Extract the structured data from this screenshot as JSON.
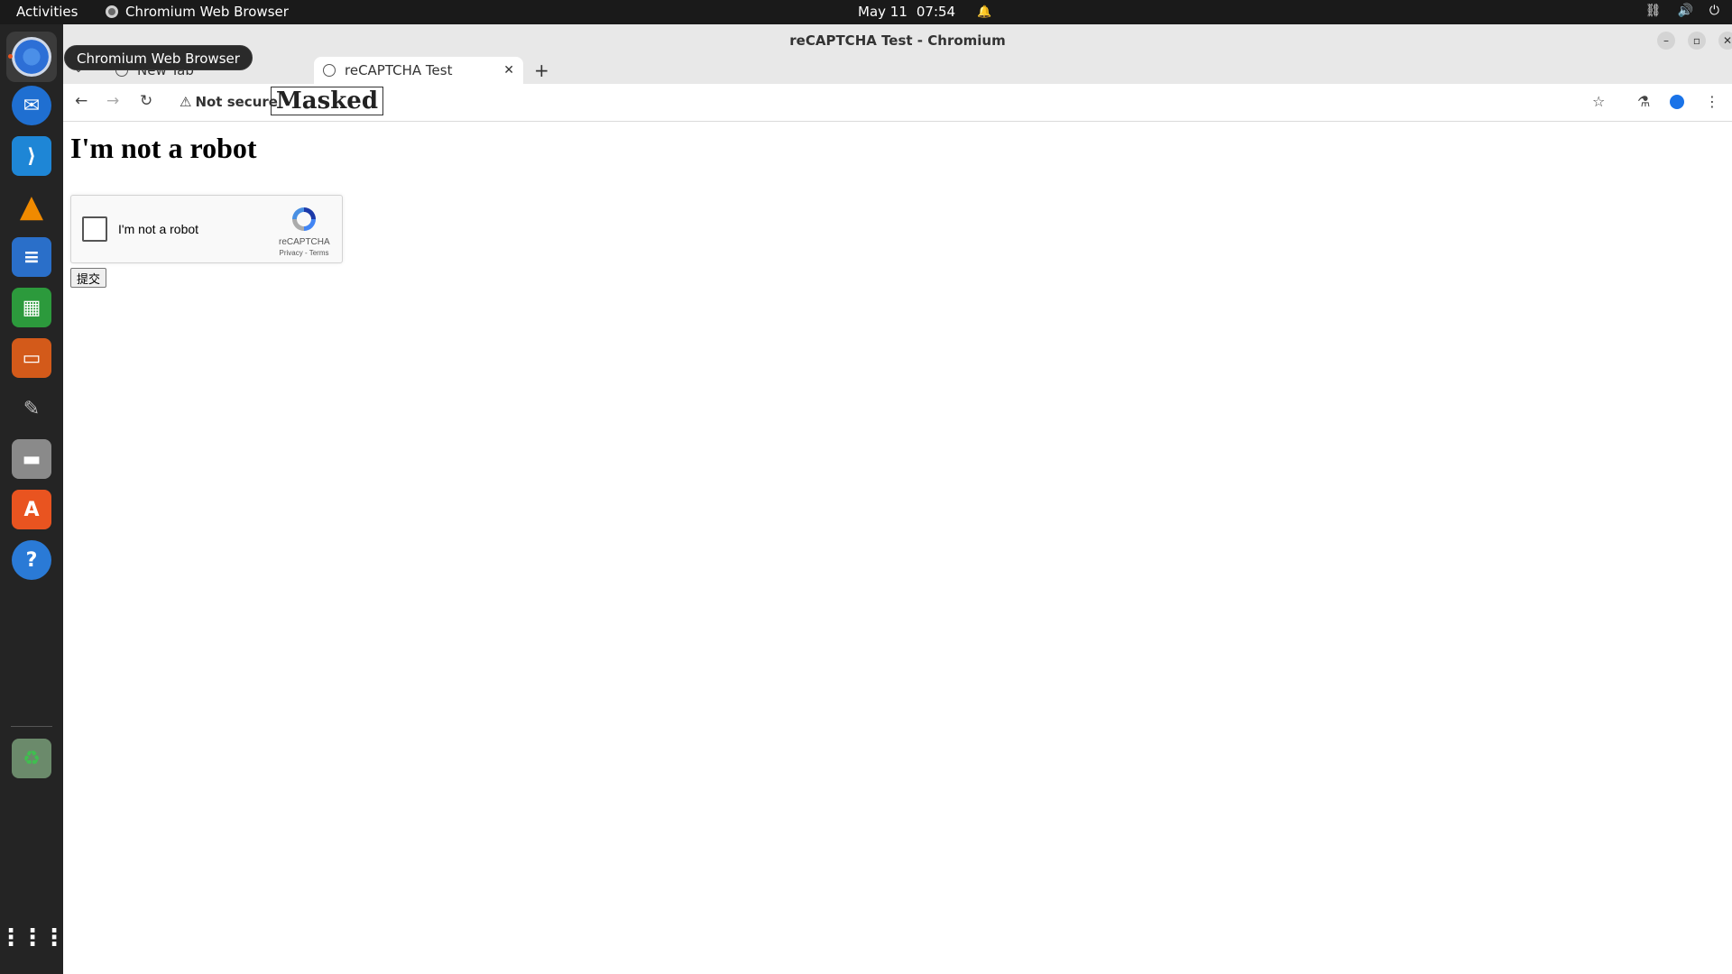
{
  "topbar": {
    "activities": "Activities",
    "app_name": "Chromium Web Browser",
    "date": "May 11",
    "time": "07:54"
  },
  "dock": {
    "tooltip": "Chromium Web Browser",
    "items": [
      {
        "icon": "chromium-icon"
      },
      {
        "icon": "thunderbird-icon"
      },
      {
        "icon": "vscode-icon"
      },
      {
        "icon": "vlc-icon"
      },
      {
        "icon": "writer-icon"
      },
      {
        "icon": "calc-icon"
      },
      {
        "icon": "impress-icon"
      },
      {
        "icon": "gimp-icon"
      },
      {
        "icon": "files-icon"
      },
      {
        "icon": "app-center-icon"
      },
      {
        "icon": "help-icon"
      },
      {
        "icon": "trash-icon"
      },
      {
        "icon": "app-grid-icon"
      }
    ]
  },
  "window": {
    "title": "reCAPTCHA Test - Chromium",
    "tabs": [
      {
        "label": "New Tab",
        "active": false
      },
      {
        "label": "reCAPTCHA Test",
        "active": true
      }
    ],
    "security_label": "Not secure",
    "url_masked": "Masked"
  },
  "page": {
    "heading": "I'm not a robot",
    "recaptcha": {
      "checkbox_label": "I'm not a robot",
      "brand": "reCAPTCHA",
      "links": "Privacy - Terms"
    },
    "submit_label": "提交"
  },
  "colors": {
    "accent": "#e95420",
    "recaptcha_blue": "#4a90e2"
  }
}
